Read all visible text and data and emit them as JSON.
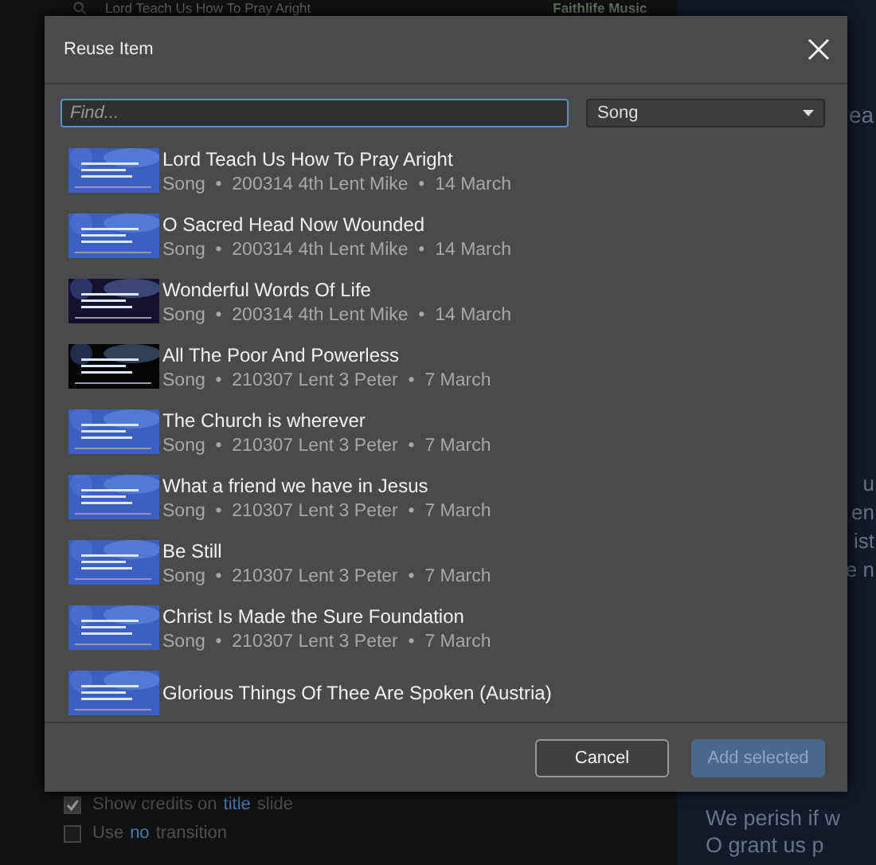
{
  "background": {
    "search_text": "Lord Teach Us How To Pray Aright",
    "brand": "Faithlife Music",
    "options": [
      {
        "checked": true,
        "parts": [
          {
            "text": "Show credits on"
          },
          {
            "text": "title",
            "kind": "link"
          },
          {
            "text": "slide"
          }
        ]
      },
      {
        "checked": false,
        "parts": [
          {
            "text": "Use"
          },
          {
            "text": "no",
            "kind": "link"
          },
          {
            "text": "transition"
          }
        ]
      }
    ],
    "preview_heading": "ea",
    "preview_fragments": [
      "u",
      "en",
      "ist",
      "e n"
    ],
    "preview_lines": [
      "We perish if w",
      "O grant us p"
    ]
  },
  "dialog": {
    "title": "Reuse Item",
    "search": {
      "placeholder": "Find..."
    },
    "filter": {
      "value": "Song"
    },
    "items": [
      {
        "title": "Lord Teach Us How To Pray Aright",
        "meta": "Song  •  200314 4th Lent Mike  •  14 March",
        "color": "#3d5fc4"
      },
      {
        "title": "O Sacred Head Now Wounded",
        "meta": "Song  •  200314 4th Lent Mike  •  14 March",
        "color": "#3d5fc4"
      },
      {
        "title": "Wonderful Words Of Life",
        "meta": "Song  •  200314 4th Lent Mike  •  14 March",
        "color": "#14102e"
      },
      {
        "title": "All The Poor And Powerless",
        "meta": "Song  •  210307 Lent 3 Peter  •  7 March",
        "color": "#050505"
      },
      {
        "title": "The Church is wherever",
        "meta": "Song  •  210307 Lent 3 Peter  •  7 March",
        "color": "#3d5fc4"
      },
      {
        "title": "What a friend we have in Jesus",
        "meta": "Song  •  210307 Lent 3 Peter  •  7 March",
        "color": "#3d5fc4"
      },
      {
        "title": "Be Still",
        "meta": "Song  •  210307 Lent 3 Peter  •  7 March",
        "color": "#3d5fc4"
      },
      {
        "title": "Christ Is Made the Sure Foundation",
        "meta": "Song  •  210307 Lent 3 Peter  •  7 March",
        "color": "#3d5fc4"
      },
      {
        "title": "Glorious Things Of Thee Are Spoken (Austria)",
        "color": "#3d5fc4"
      }
    ],
    "buttons": [
      {
        "label": "Cancel",
        "disabled": false
      },
      {
        "label": "Add selected",
        "disabled": true
      }
    ]
  }
}
